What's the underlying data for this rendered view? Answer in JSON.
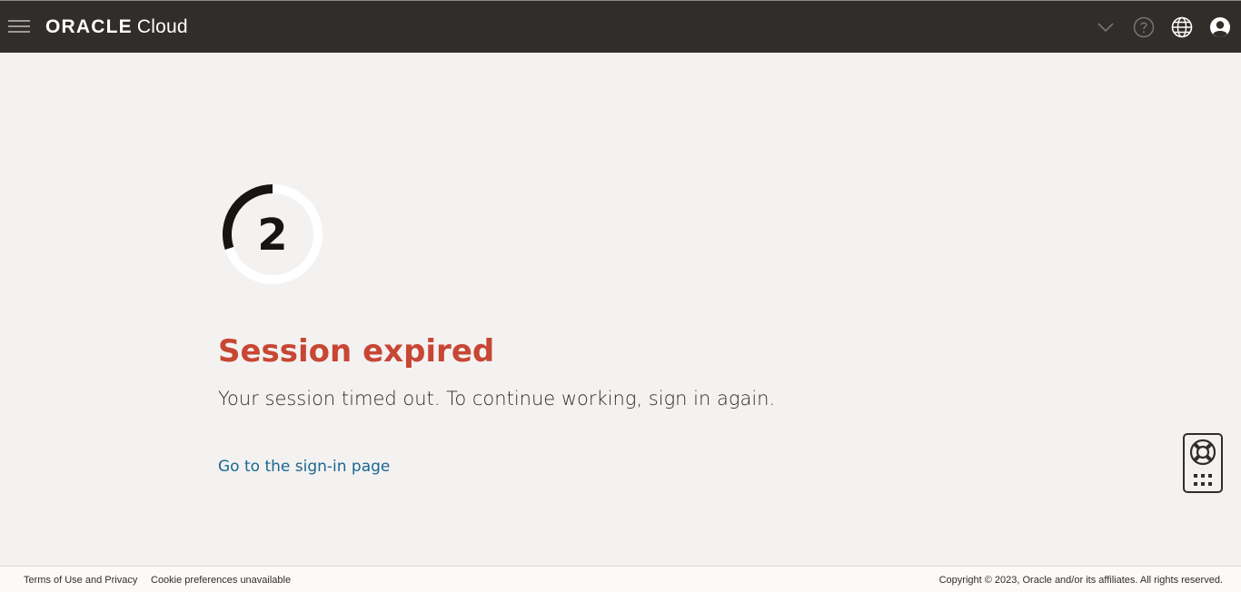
{
  "header": {
    "logo_brand": "ORACLE",
    "logo_product": "Cloud",
    "icons": [
      "menu-icon",
      "chevron-down-icon",
      "help-icon",
      "globe-icon",
      "user-icon"
    ],
    "background_color": "#312d2a"
  },
  "countdown": {
    "value": "2",
    "progress_fraction": 0.3
  },
  "main": {
    "title": "Session expired",
    "message": "Your session timed out. To continue working, sign in again.",
    "link_label": "Go to the sign-in page",
    "title_color": "#c74634",
    "link_color": "#1b6792"
  },
  "help_widget": {
    "icons": [
      "lifebuoy-icon",
      "apps-grid-icon"
    ]
  },
  "footer": {
    "terms": "Terms of Use and Privacy",
    "cookie": "Cookie preferences unavailable",
    "copyright": "Copyright © 2023, Oracle and/or its affiliates. All rights reserved."
  }
}
